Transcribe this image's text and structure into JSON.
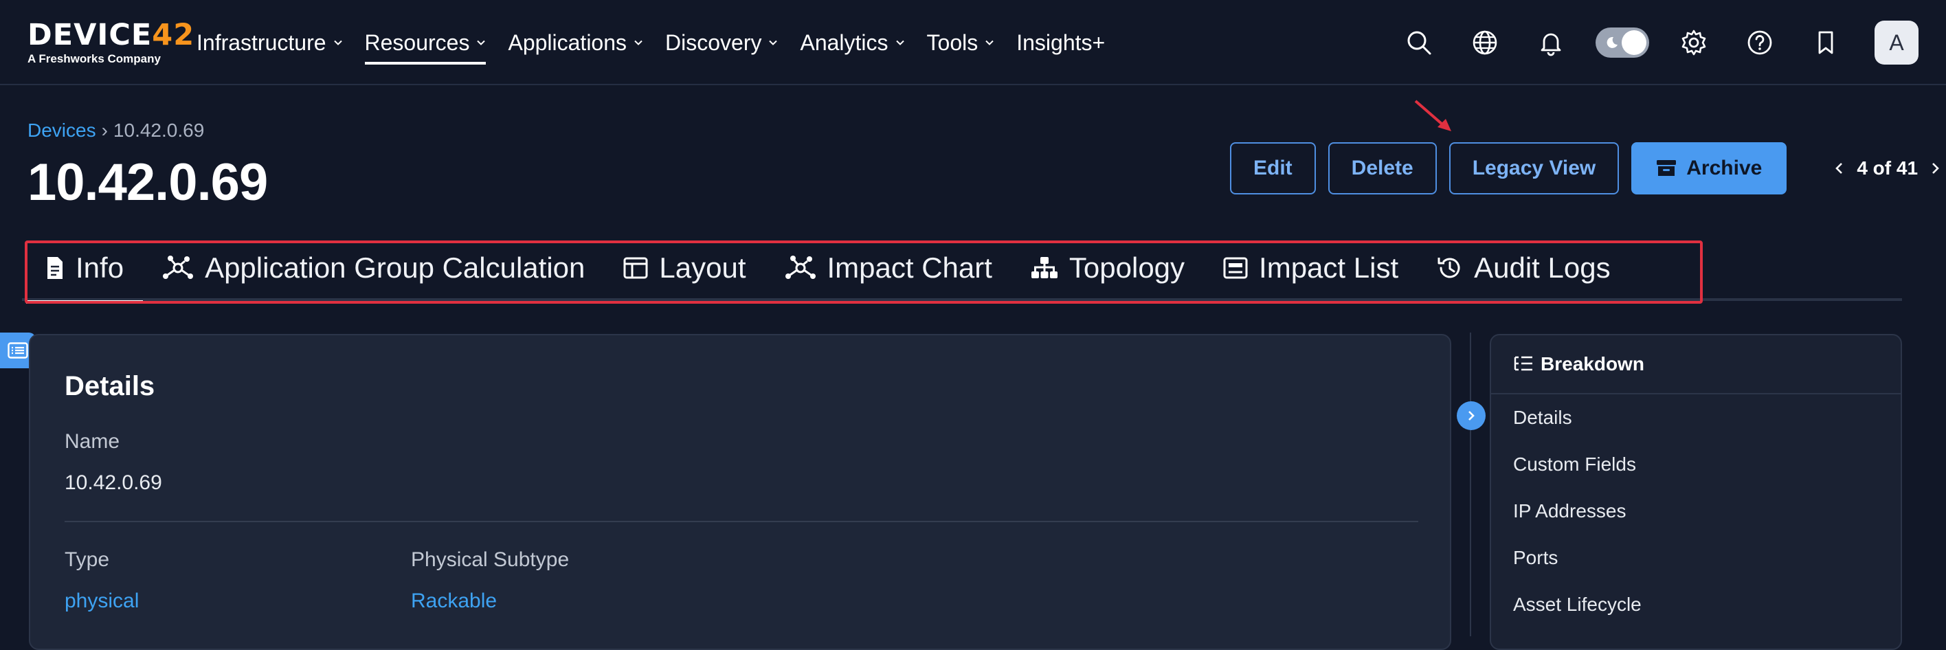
{
  "logo": {
    "brand_a": "DEVICE",
    "brand_b": "42",
    "tagline": "A Freshworks Company"
  },
  "nav": {
    "items": [
      {
        "label": "Infrastructure",
        "dropdown": true
      },
      {
        "label": "Resources",
        "dropdown": true,
        "active": true
      },
      {
        "label": "Applications",
        "dropdown": true
      },
      {
        "label": "Discovery",
        "dropdown": true
      },
      {
        "label": "Analytics",
        "dropdown": true
      },
      {
        "label": "Tools",
        "dropdown": true
      },
      {
        "label": "Insights+",
        "dropdown": false
      }
    ],
    "tool_icons": [
      "search-icon",
      "globe-icon",
      "bell-icon",
      "theme-toggle",
      "gear-icon",
      "help-icon",
      "bookmark-icon"
    ],
    "avatar_initial": "A"
  },
  "breadcrumb": {
    "root": "Devices",
    "separator": "›",
    "current": "10.42.0.69"
  },
  "page_title": "10.42.0.69",
  "actions": {
    "edit": "Edit",
    "delete": "Delete",
    "legacy": "Legacy View",
    "archive": "Archive"
  },
  "pager": {
    "text": "4 of 41"
  },
  "tabs": [
    {
      "label": "Info",
      "icon": "document-icon",
      "active": true
    },
    {
      "label": "Application Group Calculation",
      "icon": "network-icon"
    },
    {
      "label": "Layout",
      "icon": "layout-icon"
    },
    {
      "label": "Impact Chart",
      "icon": "network-icon"
    },
    {
      "label": "Topology",
      "icon": "hierarchy-icon"
    },
    {
      "label": "Impact List",
      "icon": "list-icon"
    },
    {
      "label": "Audit Logs",
      "icon": "history-icon"
    }
  ],
  "details": {
    "heading": "Details",
    "name_label": "Name",
    "name_value": "10.42.0.69",
    "type_label": "Type",
    "type_value": "physical",
    "subtype_label": "Physical Subtype",
    "subtype_value": "Rackable"
  },
  "breakdown": {
    "heading": "Breakdown",
    "items": [
      "Details",
      "Custom Fields",
      "IP Addresses",
      "Ports",
      "Asset Lifecycle"
    ]
  },
  "colors": {
    "accent": "#4a9af0",
    "link": "#3ea3f3",
    "highlight": "#e03040",
    "background": "#111727"
  }
}
